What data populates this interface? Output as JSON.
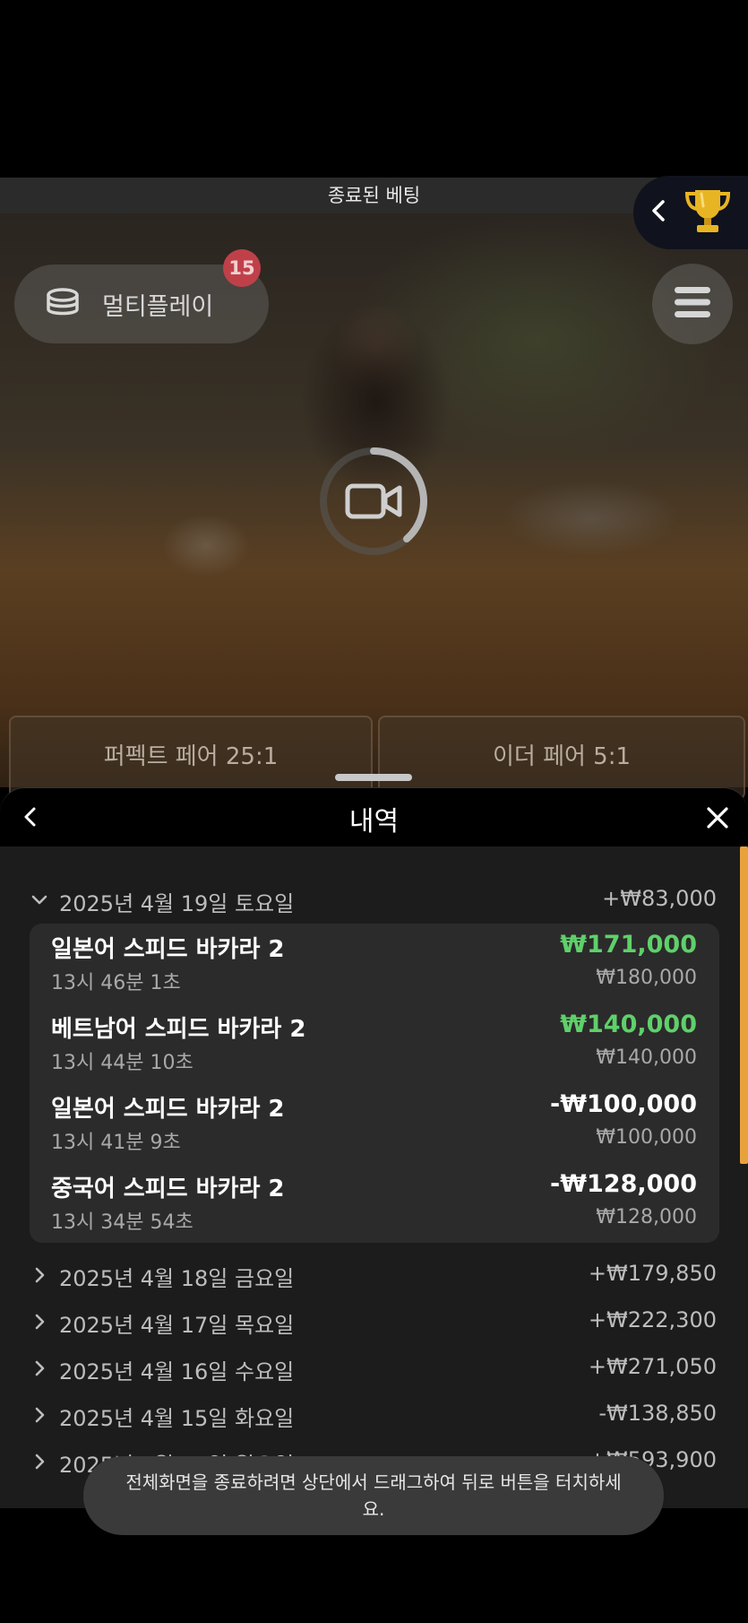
{
  "top_bar": {
    "title": "종료된 베팅"
  },
  "video": {
    "multiplay_label": "멀티플레이",
    "multiplay_badge": "15",
    "bets": [
      {
        "label": "퍼펙트 페어 25:1"
      },
      {
        "label": "이더 페어 5:1"
      }
    ]
  },
  "history": {
    "title": "내역",
    "expanded_day": {
      "date": "2025년 4월 19일 토요일",
      "total": "+₩83,000",
      "bets": [
        {
          "game": "일본어 스피드 바카라 2",
          "time": "13시 46분 1초",
          "result": "₩171,000",
          "stake": "₩180,000",
          "outcome": "win"
        },
        {
          "game": "베트남어 스피드 바카라 2",
          "time": "13시 44분 10초",
          "result": "₩140,000",
          "stake": "₩140,000",
          "outcome": "win"
        },
        {
          "game": "일본어 스피드 바카라 2",
          "time": "13시 41분 9초",
          "result": "-₩100,000",
          "stake": "₩100,000",
          "outcome": "loss"
        },
        {
          "game": "중국어 스피드 바카라 2",
          "time": "13시 34분 54초",
          "result": "-₩128,000",
          "stake": "₩128,000",
          "outcome": "loss"
        }
      ]
    },
    "days": [
      {
        "date": "2025년 4월 18일 금요일",
        "total": "+₩179,850"
      },
      {
        "date": "2025년 4월 17일 목요일",
        "total": "+₩222,300"
      },
      {
        "date": "2025년 4월 16일 수요일",
        "total": "+₩271,050"
      },
      {
        "date": "2025년 4월 15일 화요일",
        "total": "-₩138,850"
      },
      {
        "date": "2025년 4월 14일 월요일",
        "total": "+₩593,900"
      }
    ]
  },
  "toast": {
    "text": "전체화면을 종료하려면 상단에서 드래그하여 뒤로 버튼을 터치하세요."
  },
  "icons": {
    "multiplay": "chips-stack-icon",
    "menu": "hamburger-menu-icon",
    "trophy": "trophy-icon",
    "camera": "video-camera-icon",
    "back": "chevron-left-icon",
    "close": "close-icon"
  },
  "colors": {
    "win": "#5fd06a",
    "badge": "#c0404a",
    "scrollbar": "#e8a23c",
    "trophy": "#e7b524"
  }
}
